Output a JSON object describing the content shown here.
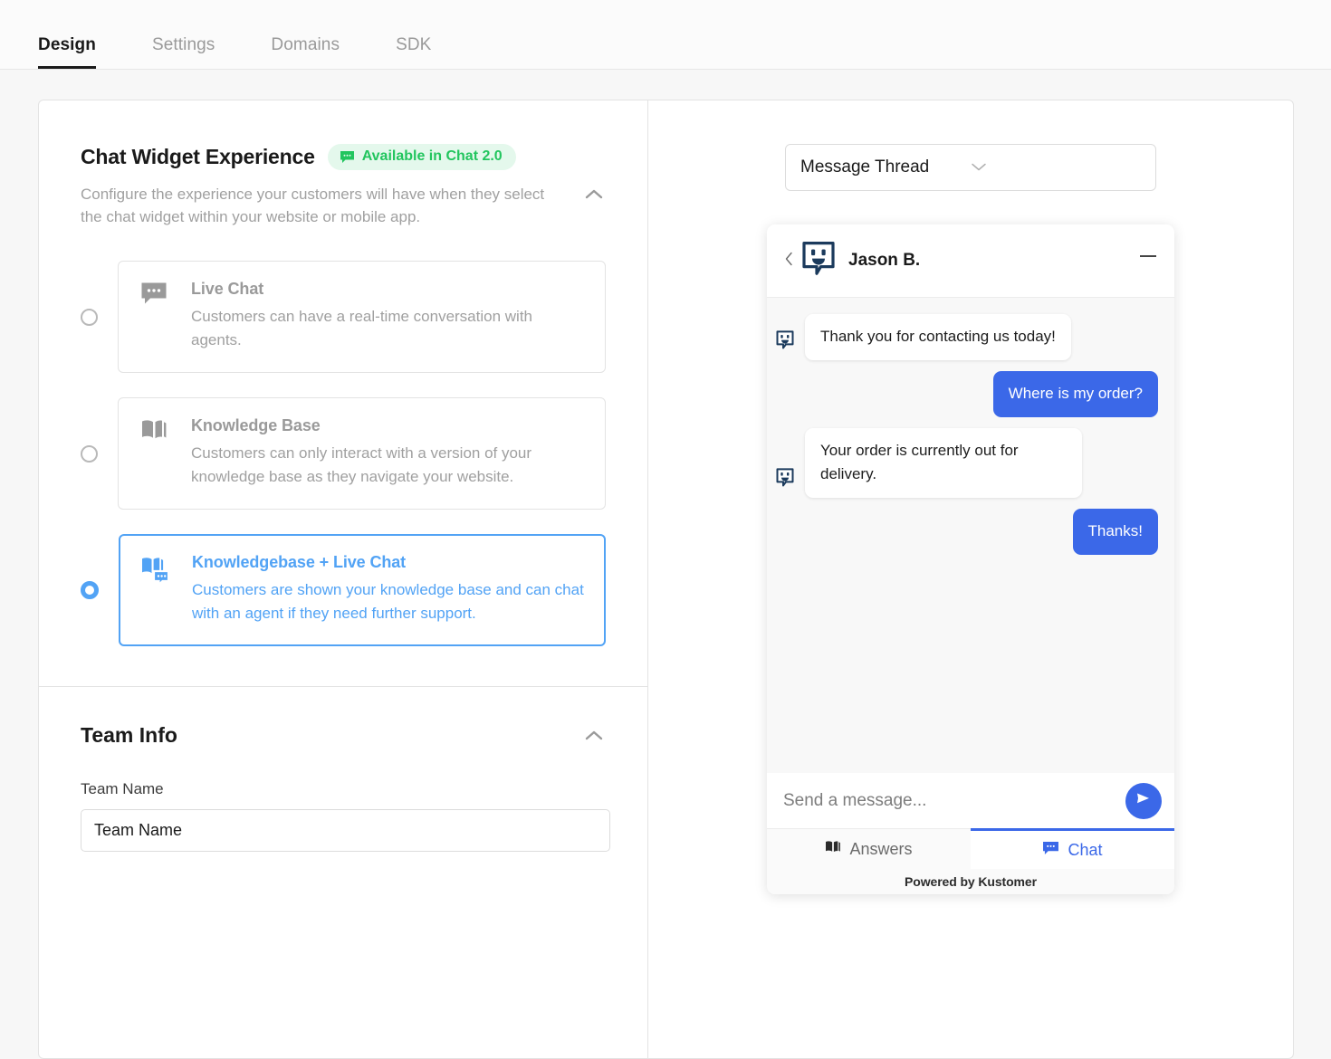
{
  "tabs": [
    {
      "label": "Design",
      "active": true
    },
    {
      "label": "Settings",
      "active": false
    },
    {
      "label": "Domains",
      "active": false
    },
    {
      "label": "SDK",
      "active": false
    }
  ],
  "colors": {
    "accent_blue": "#3b68e8",
    "light_blue": "#52a3f5",
    "green": "#22c55e",
    "badge_bg": "#e4f8ec",
    "navy": "#1b3a5c"
  },
  "experience": {
    "title": "Chat Widget Experience",
    "badge": "Available in Chat 2.0",
    "description": "Configure the experience your customers will have when they select the chat widget within your website or mobile app.",
    "options": [
      {
        "title": "Live Chat",
        "description": "Customers can have a real-time conversation with agents.",
        "icon": "chat-bubble-icon",
        "selected": false
      },
      {
        "title": "Knowledge Base",
        "description": "Customers can only interact with a version of your knowledge base as they navigate your website.",
        "icon": "book-icon",
        "selected": false
      },
      {
        "title": "Knowledgebase + Live Chat",
        "description": "Customers are shown your knowledge base and can chat with an agent if they need further support.",
        "icon": "book-plus-chat-icon",
        "selected": true
      }
    ]
  },
  "team_info": {
    "title": "Team Info",
    "field_label": "Team Name",
    "field_placeholder": "Team Name",
    "field_value": ""
  },
  "preview": {
    "selector_value": "Message Thread",
    "widget": {
      "agent_name": "Jason B.",
      "messages": [
        {
          "from": "agent",
          "text": "Thank you for contacting us today!"
        },
        {
          "from": "user",
          "text": "Where is my order?"
        },
        {
          "from": "agent",
          "text": "Your order is currently out for delivery."
        },
        {
          "from": "user",
          "text": "Thanks!"
        }
      ],
      "input_placeholder": "Send a message...",
      "input_value": "",
      "tabs": [
        {
          "label": "Answers",
          "icon": "book-icon",
          "active": false
        },
        {
          "label": "Chat",
          "icon": "chat-bubble-icon",
          "active": true
        }
      ],
      "footer": "Powered by Kustomer"
    },
    "launcher_icon": "kustomer-smiley-bubble-icon"
  }
}
